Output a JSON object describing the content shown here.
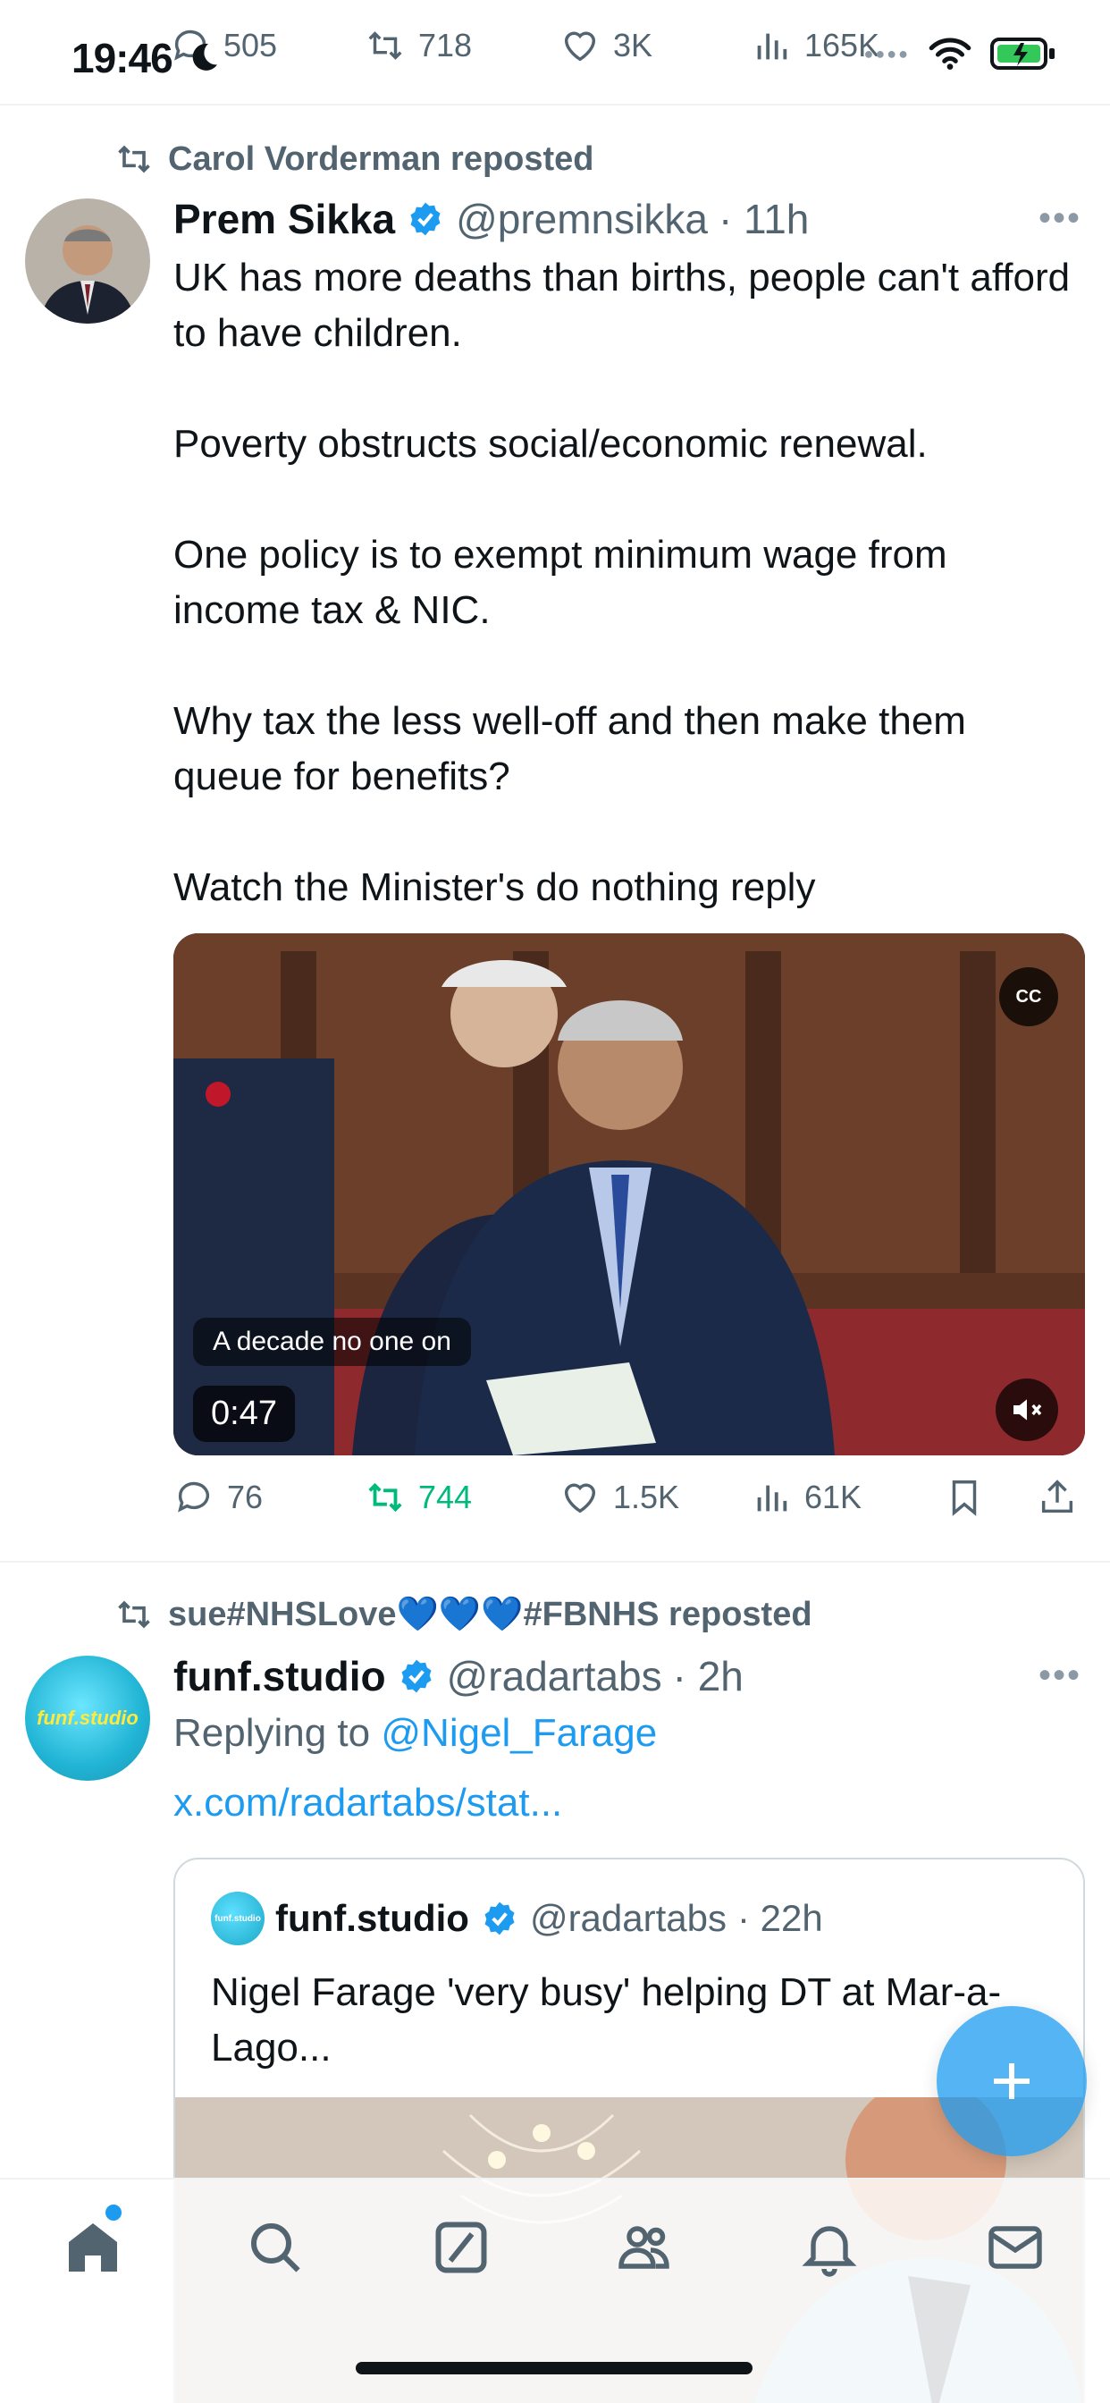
{
  "status_bar": {
    "time": "19:46"
  },
  "top_actions": {
    "replies": "505",
    "reposts": "718",
    "likes": "3K",
    "views": "165K"
  },
  "tweets": [
    {
      "reposted_by": "Carol Vorderman reposted",
      "author_name": "Prem Sikka",
      "handle": "@premnsikka",
      "time": "· 11h",
      "paragraphs": [
        "UK has more deaths than births, people can't afford to have children.",
        "Poverty obstructs social/economic renewal.",
        "One policy is to exempt minimum wage from income tax & NIC.",
        "Why tax the less well-off and then make them queue for benefits?",
        "Watch the Minister's do nothing reply"
      ],
      "media": {
        "cc_label": "CC",
        "caption": "A decade no one on",
        "duration": "0:47"
      },
      "stats": {
        "replies": "76",
        "reposts": "744",
        "likes": "1.5K",
        "views": "61K"
      }
    },
    {
      "reposted_by": "sue#NHSLove💙💙💙#FBNHS reposted",
      "author_name": "funf.studio",
      "handle": "@radartabs",
      "time": "· 2h",
      "avatar_text": "funf.studio",
      "replying_prefix": "Replying to",
      "replying_handle": "@Nigel_Farage",
      "link": "x.com/radartabs/stat...",
      "quote": {
        "author_name": "funf.studio",
        "handle": "@radartabs",
        "time": "· 22h",
        "avatar_text": "funf.studio",
        "text": "Nigel Farage 'very busy' helping DT at Mar-a-Lago..."
      }
    }
  ],
  "colors": {
    "accent": "#1d9bf0",
    "repost_green": "#00ba7c",
    "muted": "#536471",
    "text": "#0f1419"
  }
}
